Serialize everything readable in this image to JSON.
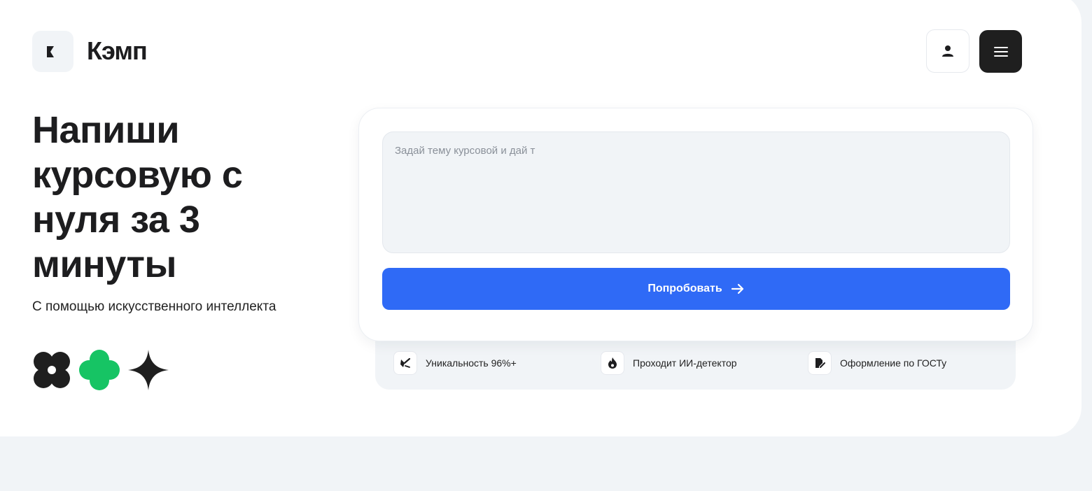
{
  "header": {
    "brand": "Кэмп",
    "logo_icon": "k-logo-icon",
    "user_icon": "user-icon",
    "menu_icon": "hamburger-menu-icon"
  },
  "hero": {
    "title": "Напиши курсовую с нуля за 3 минуты",
    "subtitle": "С помощью искусственного интеллекта"
  },
  "form": {
    "prompt_value": "Задай тему курсовой и дай т",
    "submit_label": "Попробовать",
    "submit_icon": "arrow-right-icon"
  },
  "features": [
    {
      "label": "Уникальность 96%+",
      "icon": "broom-icon"
    },
    {
      "label": "Проходит ИИ-детектор",
      "icon": "fire-icon"
    },
    {
      "label": "Оформление по ГОСТу",
      "icon": "document-edit-icon"
    }
  ],
  "colors": {
    "accent": "#2f6af6",
    "green": "#16c464",
    "dark": "#1f1f1f",
    "background": "#f1f4f7"
  }
}
